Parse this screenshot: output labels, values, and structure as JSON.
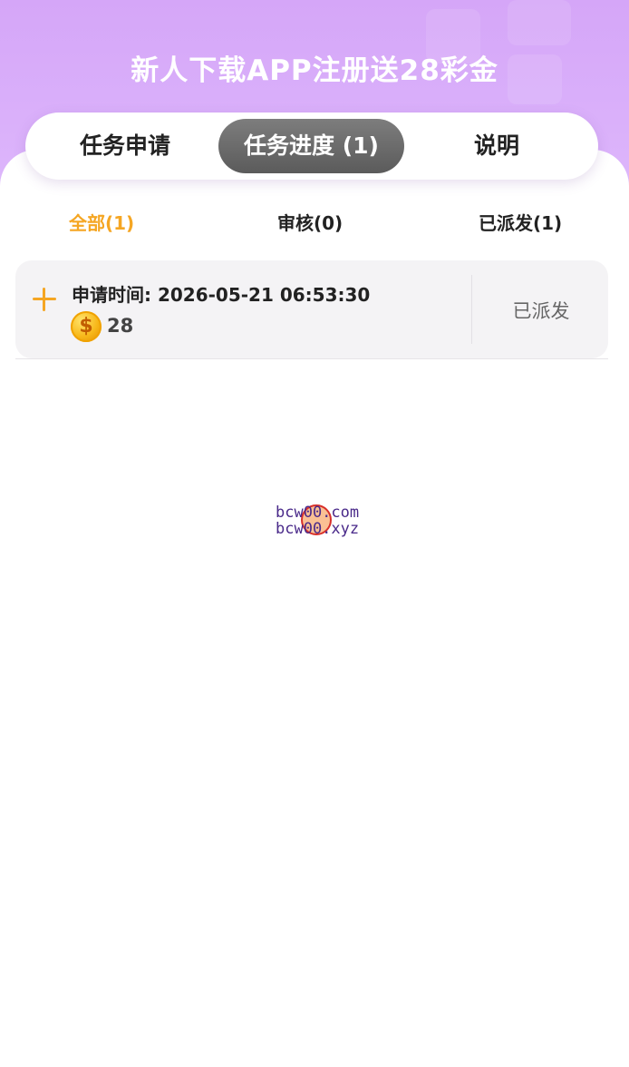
{
  "header": {
    "title": "新人下载APP注册送28彩金"
  },
  "tabs": [
    {
      "label": "任务申请"
    },
    {
      "label": "任务进度 (1)"
    },
    {
      "label": "说明"
    }
  ],
  "filters": [
    {
      "label": "全部(1)"
    },
    {
      "label": "审核(0)"
    },
    {
      "label": "已派发(1)"
    }
  ],
  "record": {
    "time_text": "申请时间: 2026-05-21 06:53:30",
    "coin_symbol": "$",
    "amount": "28",
    "status": "已派发"
  },
  "watermark": {
    "line1": "bcw00.com",
    "line2": "bcw00.xyz"
  },
  "colors": {
    "accent": "#f5a623",
    "hero_purple": "#d5a6f8",
    "active_tab": "#6b6b6b"
  }
}
